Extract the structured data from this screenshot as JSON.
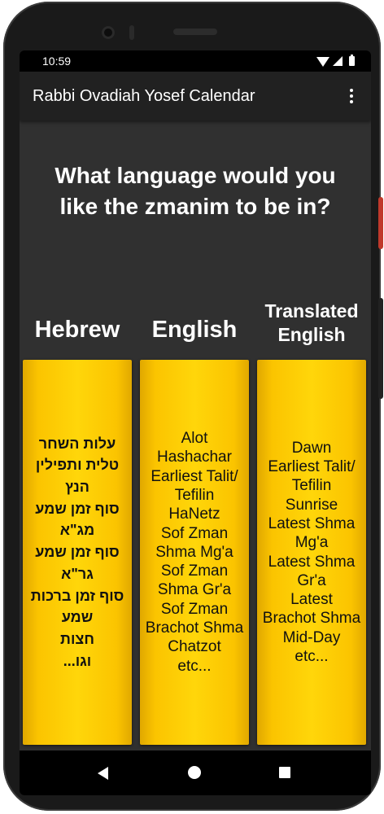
{
  "status_bar": {
    "time": "10:59"
  },
  "app_bar": {
    "title": "Rabbi Ovadiah Yosef Calendar"
  },
  "question": "What language would you like the zmanim to be in?",
  "options": {
    "hebrew": {
      "label": "Hebrew",
      "sample": "עלות השחר\nטלית ותפילין\nהנץ\nסוף זמן שמע\nמג\"א\nסוף זמן שמע\nגר\"א\nסוף זמן ברכות\nשמע\nחצות\nוגו..."
    },
    "english": {
      "label": "English",
      "sample": "Alot\nHashachar\nEarliest Talit/\nTefilin\nHaNetz\nSof Zman\nShma Mg'a\nSof Zman\nShma Gr'a\nSof Zman\nBrachot Shma\nChatzot\netc..."
    },
    "translated": {
      "label": "Translated English",
      "sample": "Dawn\nEarliest Talit/\nTefilin\nSunrise\nLatest Shma\nMg'a\nLatest Shma\nGr'a\nLatest\nBrachot Shma\nMid-Day\netc..."
    }
  },
  "icons": {
    "menu": "more-vert-icon",
    "back": "back-triangle-icon",
    "home": "home-circle-icon",
    "recent": "recent-apps-square-icon"
  },
  "colors": {
    "screen_background": "#303030",
    "app_bar": "#212121",
    "card_gold": "#ffd60a",
    "phone_body": "#1a1a1a",
    "power_button": "#c0392b"
  }
}
